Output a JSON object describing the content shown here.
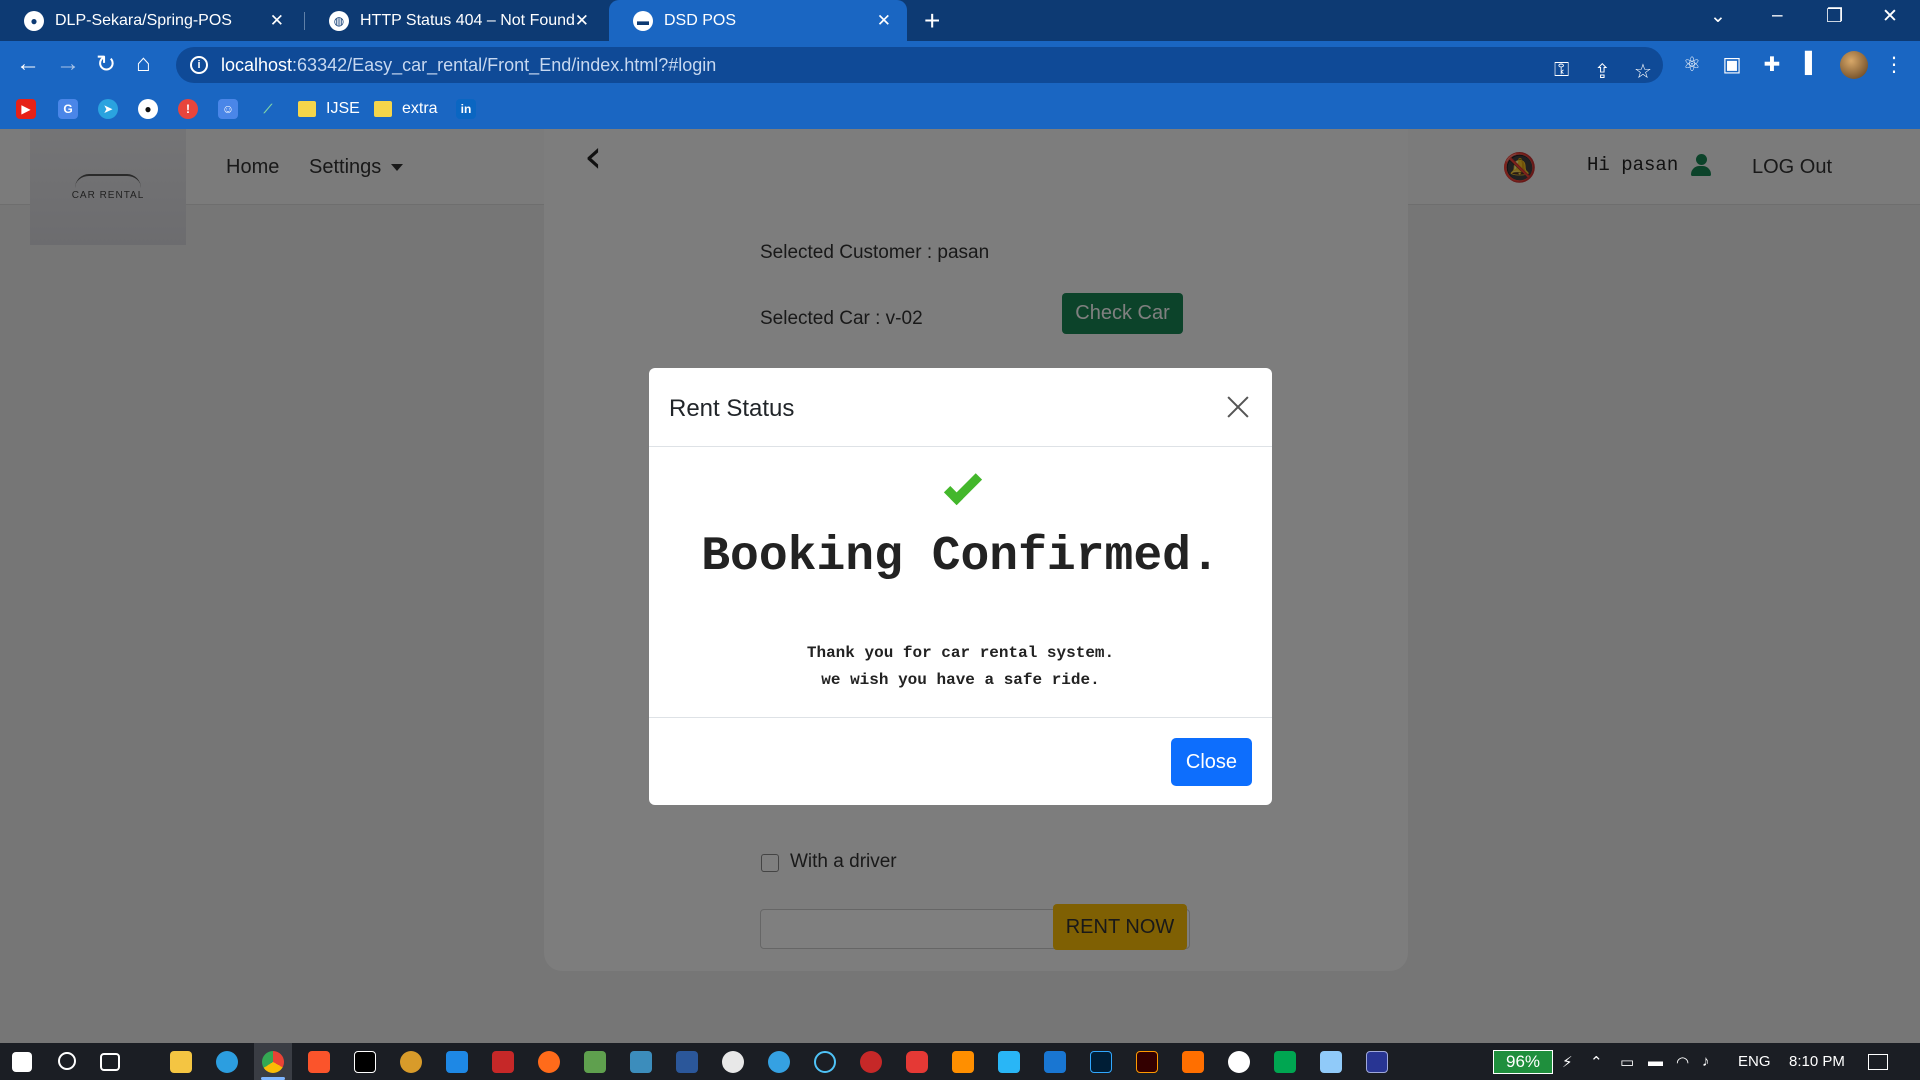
{
  "browser": {
    "tabs": [
      {
        "label": "DLP-Sekara/Spring-POS",
        "icon": "github-icon"
      },
      {
        "label": "HTTP Status 404 – Not Found",
        "icon": "globe-icon"
      },
      {
        "label": "DSD POS",
        "icon": "car-favicon-icon"
      }
    ],
    "active_tab": 2,
    "url_host": "localhost",
    "url_path": ":63342/Easy_car_rental/Front_End/index.html?#login",
    "bookmarks": [
      {
        "label": "IJSE",
        "type": "folder"
      },
      {
        "label": "extra",
        "type": "folder"
      }
    ]
  },
  "navbar": {
    "logo_text": "CAR RENTAL",
    "home": "Home",
    "settings": "Settings",
    "greeting": "Hi pasan",
    "logout": "LOG Out"
  },
  "form": {
    "selected_customer": "Selected Customer : pasan",
    "selected_car": "Selected Car : v-02",
    "check_car": "Check Car",
    "driver_label": "With a driver",
    "rent_now": "RENT NOW"
  },
  "modal": {
    "title": "Rent Status",
    "heading": "Booking Confirmed.",
    "line1": "Thank you for car rental system.",
    "line2": "we wish you have a safe ride.",
    "close": "Close"
  },
  "taskbar": {
    "battery": "96%",
    "language": "ENG",
    "time": "8:10 PM"
  },
  "colors": {
    "tabbar": "#0d3a73",
    "toolbar": "#1a66c2",
    "success": "#198754",
    "warning": "#ffc107",
    "primary": "#0d6efd",
    "checkmark": "#43b72b"
  }
}
